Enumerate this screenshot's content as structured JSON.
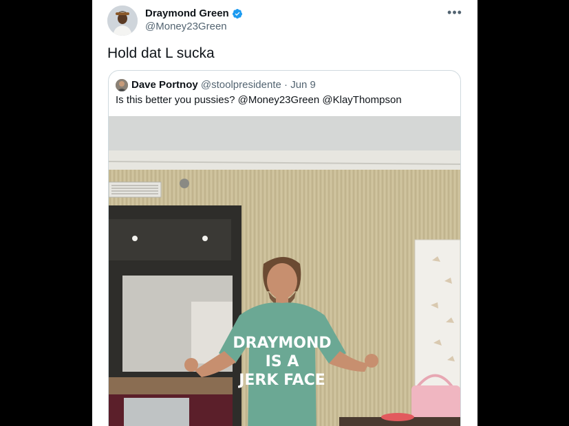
{
  "tweet": {
    "author_name": "Draymond Green",
    "author_handle": "@Money23Green",
    "verified_icon": "verified-badge-icon",
    "more_icon": "more-options-icon",
    "text": "Hold dat L sucka"
  },
  "quoted_tweet": {
    "author_name": "Dave Portnoy",
    "author_handle": "@stoolpresidente",
    "separator": "·",
    "date": "Jun 9",
    "text": "Is this better you pussies? @Money23Green @KlayThompson",
    "photo": {
      "shirt_text_line1": "DRAYMOND",
      "shirt_text_line2": "IS A",
      "shirt_text_line3": "JERK FACE"
    }
  },
  "colors": {
    "background": "#000000",
    "card": "#ffffff",
    "text_primary": "#0f1419",
    "text_secondary": "#536471",
    "verified_blue": "#1d9bf0",
    "border": "#cfd9de"
  }
}
